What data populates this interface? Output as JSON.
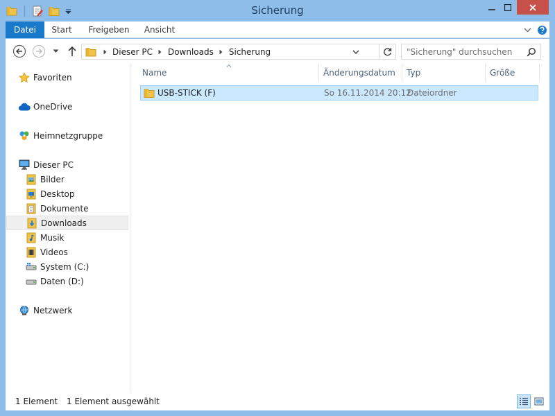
{
  "window": {
    "title": "Sicherung"
  },
  "ribbon": {
    "tabs": {
      "datei": "Datei",
      "start": "Start",
      "freigeben": "Freigeben",
      "ansicht": "Ansicht"
    }
  },
  "address": {
    "crumbs": [
      "Dieser PC",
      "Downloads",
      "Sicherung"
    ]
  },
  "search": {
    "placeholder": "\"Sicherung\" durchsuchen"
  },
  "nav": {
    "favoriten": "Favoriten",
    "onedrive": "OneDrive",
    "heimnetz": "Heimnetzgruppe",
    "dieser_pc": "Dieser PC",
    "pc_items": [
      "Bilder",
      "Desktop",
      "Dokumente",
      "Downloads",
      "Musik",
      "Videos",
      "System (C:)",
      "Daten (D:)"
    ],
    "netzwerk": "Netzwerk"
  },
  "columns": {
    "name": "Name",
    "date": "Änderungsdatum",
    "type": "Typ",
    "size": "Größe"
  },
  "files": [
    {
      "name": "USB-STICK (F)",
      "date": "So 16.11.2014 20:12",
      "type": "Dateiordner"
    }
  ],
  "status": {
    "count": "1 Element",
    "selected": "1 Element ausgewählt"
  },
  "colors": {
    "frame": "#8fbdea",
    "accent": "#1979ca",
    "selection": "#cce8ff",
    "close": "#c7504a"
  }
}
